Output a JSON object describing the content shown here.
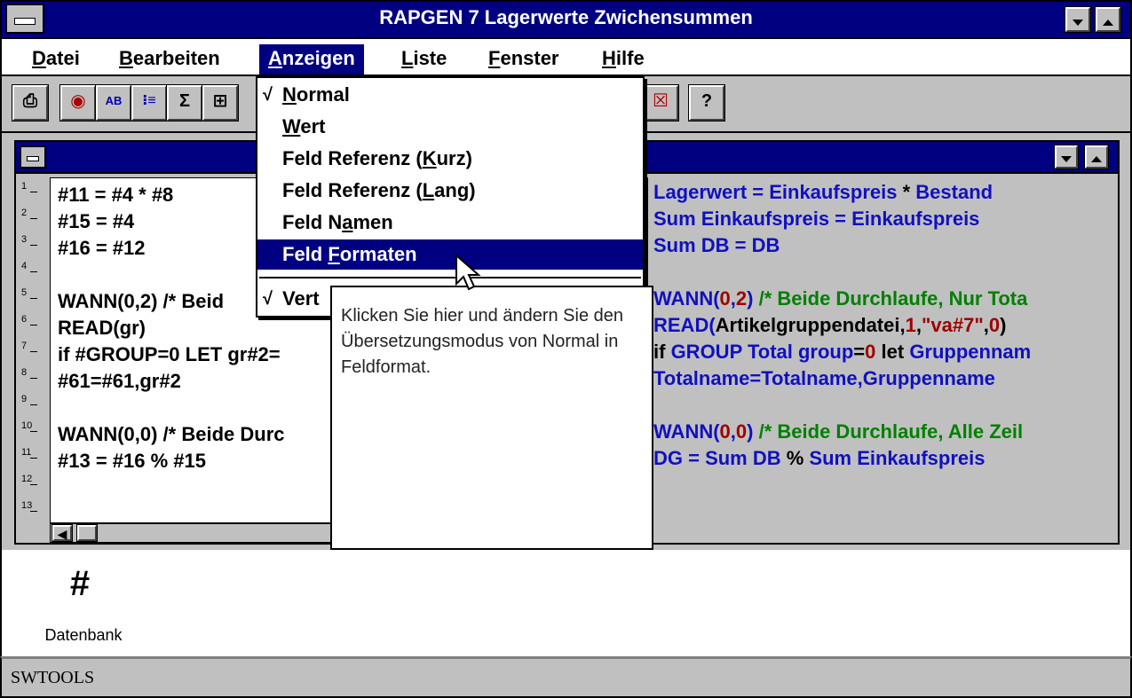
{
  "window": {
    "title": "RAPGEN 7 Lagerwerte Zwichensummen"
  },
  "menubar": {
    "items": [
      {
        "pre": "",
        "u": "D",
        "post": "atei"
      },
      {
        "pre": "",
        "u": "B",
        "post": "earbeiten"
      },
      {
        "pre": "",
        "u": "A",
        "post": "nzeigen"
      },
      {
        "pre": "",
        "u": "L",
        "post": "iste"
      },
      {
        "pre": "",
        "u": "F",
        "post": "enster"
      },
      {
        "pre": "",
        "u": "H",
        "post": "ilfe"
      }
    ]
  },
  "toolbar": {
    "icons": [
      "printer-icon",
      "stamp-icon",
      "ab-text-icon",
      "list-icon",
      "sigma-icon",
      "calc-icon",
      "close-x-icon",
      "help-question-icon"
    ],
    "glyphs": [
      "⎙",
      "◉",
      "AB",
      "⁝≡",
      "Σ",
      "⊞",
      "☒",
      "?"
    ]
  },
  "dropdown": {
    "items": [
      {
        "check": "√",
        "pre": "",
        "u": "N",
        "post": "ormal"
      },
      {
        "check": "",
        "pre": "",
        "u": "W",
        "post": "ert"
      },
      {
        "check": "",
        "pre": "Feld Referenz (",
        "u": "K",
        "post": "urz)"
      },
      {
        "check": "",
        "pre": "Feld Referenz (",
        "u": "L",
        "post": "ang)"
      },
      {
        "check": "",
        "pre": "Feld N",
        "u": "a",
        "post": "men"
      },
      {
        "check": "",
        "pre": "Feld ",
        "u": "F",
        "post": "ormaten"
      },
      {
        "check": "√",
        "pre": "Vert",
        "u": "",
        "post": ""
      }
    ],
    "highlighted_index": 5
  },
  "tooltip": {
    "text": "Klicken Sie hier und ändern Sie den Übersetzungsmodus von Normal in Feldformat."
  },
  "editor": {
    "line_numbers": [
      "1",
      "2",
      "3",
      "4",
      "5",
      "6",
      "7",
      "8",
      "9",
      "10",
      "11",
      "12",
      "13"
    ],
    "left_lines": [
      "#11 = #4 * #8",
      "#15 = #4",
      "#16 = #12",
      "",
      "WANN(0,2) /* Beid",
      "READ(gr)",
      "if #GROUP=0 LET gr#2=",
      "#61=#61,gr#2",
      "",
      "WANN(0,0) /* Beide Durc",
      "#13 = #16 % #15",
      "",
      ""
    ],
    "right_lines": [
      [
        {
          "t": "Lagerwert = Einkaufspreis ",
          "c": "#1010c0"
        },
        {
          "t": "*",
          "c": "#000"
        },
        {
          "t": " Bestand",
          "c": "#1010c0"
        }
      ],
      [
        {
          "t": "Sum Einkaufspreis = Einkaufspreis",
          "c": "#1010c0"
        }
      ],
      [
        {
          "t": "Sum DB = DB",
          "c": "#1010c0"
        }
      ],
      [],
      [
        {
          "t": "WANN(",
          "c": "#1010c0"
        },
        {
          "t": "0",
          "c": "#a00000"
        },
        {
          "t": ",",
          "c": "#1010c0"
        },
        {
          "t": "2",
          "c": "#a00000"
        },
        {
          "t": ") ",
          "c": "#1010c0"
        },
        {
          "t": "/* Beide Durchlaufe, Nur Tota",
          "c": "#008000"
        }
      ],
      [
        {
          "t": "READ(",
          "c": "#1010c0"
        },
        {
          "t": "Artikelgruppendatei,",
          "c": "#000"
        },
        {
          "t": "1",
          "c": "#a00000"
        },
        {
          "t": ",",
          "c": "#000"
        },
        {
          "t": "\"va#7\"",
          "c": "#a00000"
        },
        {
          "t": ",",
          "c": "#000"
        },
        {
          "t": "0",
          "c": "#a00000"
        },
        {
          "t": ")",
          "c": "#000"
        }
      ],
      [
        {
          "t": "if ",
          "c": "#000"
        },
        {
          "t": "GROUP Total group",
          "c": "#1010c0"
        },
        {
          "t": "=",
          "c": "#000"
        },
        {
          "t": "0",
          "c": "#a00000"
        },
        {
          "t": " let ",
          "c": "#000"
        },
        {
          "t": "Gruppennam",
          "c": "#1010c0"
        }
      ],
      [
        {
          "t": "Totalname=Totalname,Gruppenname",
          "c": "#1010c0"
        }
      ],
      [],
      [
        {
          "t": "WANN(",
          "c": "#1010c0"
        },
        {
          "t": "0",
          "c": "#a00000"
        },
        {
          "t": ",",
          "c": "#1010c0"
        },
        {
          "t": "0",
          "c": "#a00000"
        },
        {
          "t": ") ",
          "c": "#1010c0"
        },
        {
          "t": "/* Beide Durchlaufe, Alle Zeil",
          "c": "#008000"
        }
      ],
      [
        {
          "t": "DG = Sum DB ",
          "c": "#1010c0"
        },
        {
          "t": "%",
          "c": "#000"
        },
        {
          "t": " Sum Einkaufspreis",
          "c": "#1010c0"
        }
      ]
    ]
  },
  "desktop": {
    "icon_label": "Datenbank",
    "icon_glyph": "#"
  },
  "statusbar": {
    "text": "SWTOOLS"
  }
}
